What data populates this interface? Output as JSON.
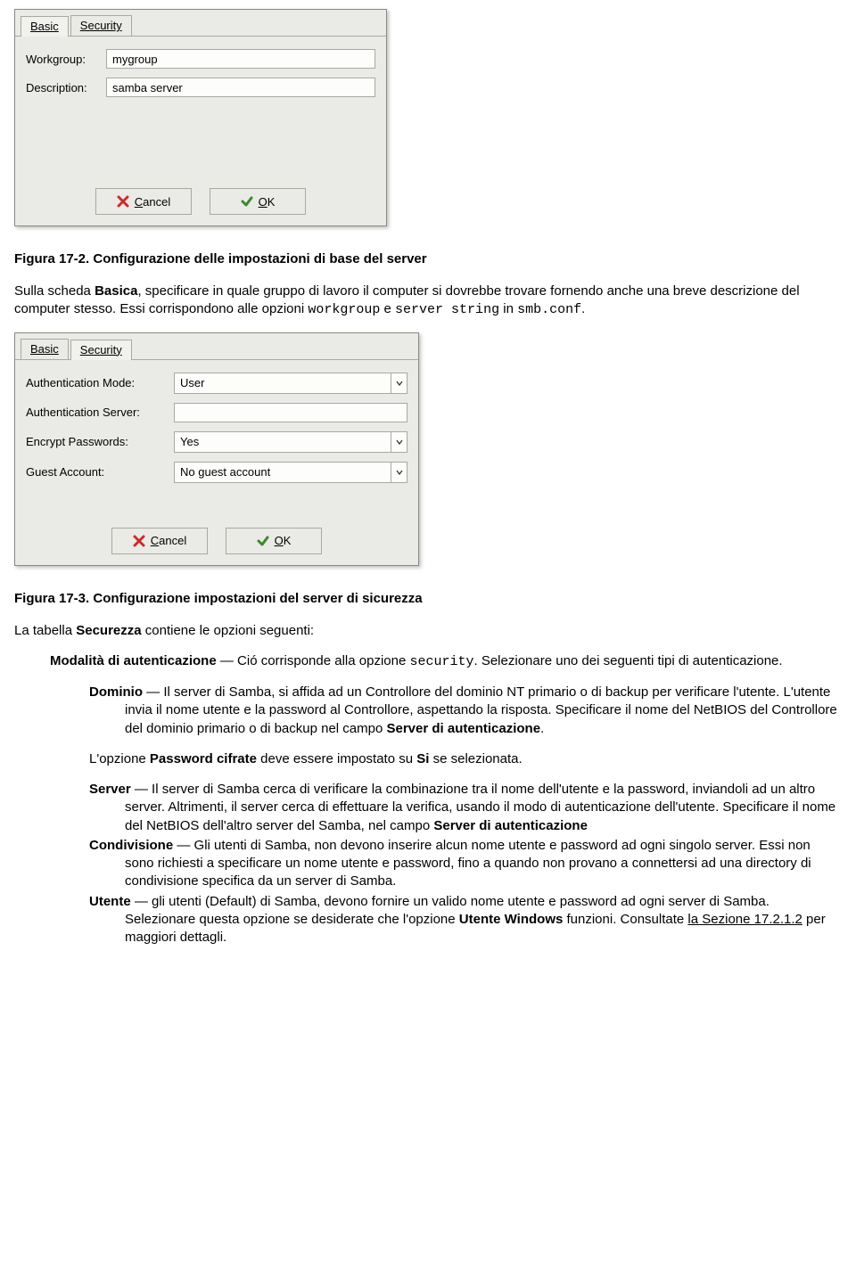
{
  "dialog1": {
    "tab_basic": "Basic",
    "tab_security": "Security",
    "lbl_workgroup": "Workgroup:",
    "val_workgroup": "mygroup",
    "lbl_description": "Description:",
    "val_description": "samba server",
    "btn_cancel": "Cancel",
    "btn_ok": "OK"
  },
  "caption1_pre": "Figura 17-2. Configurazione delle impostazioni di base del server",
  "para1": {
    "t1": "Sulla scheda ",
    "b1": "Basica",
    "t2": ", specificare in quale gruppo di lavoro il computer si dovrebbe trovare fornendo anche una breve descrizione del computer stesso. Essi corrispondono alle opzioni ",
    "m1": "workgroup",
    "t3": " e ",
    "m2": "server string",
    "t4": " in ",
    "m3": "smb.conf",
    "t5": "."
  },
  "dialog2": {
    "tab_basic": "Basic",
    "tab_security": "Security",
    "lbl_authmode": "Authentication Mode:",
    "val_authmode": "User",
    "lbl_authserver": "Authentication Server:",
    "val_authserver": "",
    "lbl_encrypt": "Encrypt Passwords:",
    "val_encrypt": "Yes",
    "lbl_guest": "Guest Account:",
    "val_guest": "No guest account",
    "btn_cancel": "Cancel",
    "btn_ok": "OK"
  },
  "caption2": "Figura 17-3. Configurazione impostazioni del server di sicurezza",
  "para2": {
    "t1": "La tabella ",
    "b1": "Securezza",
    "t2": " contiene le opzioni seguenti:"
  },
  "defs": {
    "modalita": {
      "head_b": "Modalità di autenticazione",
      "head_t1": " — Ció corrisponde alla opzione ",
      "head_m1": "security",
      "head_t2": ". Selezionare uno dei seguenti tipi di autenticazione."
    },
    "dominio": {
      "head_b": "Dominio",
      "body1": " — Il server di Samba, si affida ad un Controllore del dominio NT primario o di backup per verificare l'utente. L'utente invia il nome utente e la password al Controllore, aspettando la risposta. Specificare il nome del NetBIOS del Controllore del dominio primario o di backup nel campo ",
      "body_b1": "Server di autenticazione",
      "body2": ".",
      "p2_t1": "L'opzione ",
      "p2_b1": "Password cifrate",
      "p2_t2": " deve essere impostato su ",
      "p2_b2": "Si",
      "p2_t3": " se selezionata."
    },
    "server": {
      "head_b": "Server",
      "body1": " — Il server di Samba cerca di verificare la combinazione tra il nome dell'utente e la password, inviandoli ad un altro server. Altrimenti, il server cerca di effettuare la verifica, usando il modo di autenticazione dell'utente. Specificare il nome del NetBIOS dell'altro server del Samba, nel campo ",
      "body_b1": "Server di autenticazione"
    },
    "condivisione": {
      "head_b": "Condivisione",
      "body1": " — Gli utenti di Samba, non devono inserire alcun nome utente e password ad ogni singolo server. Essi non sono richiesti a specificare un nome utente e password, fino a quando non provano a connettersi ad una directory di condivisione specifica da un server di Samba."
    },
    "utente": {
      "head_b": "Utente",
      "body1": " — gli utenti (Default) di Samba, devono fornire un valido nome utente e password ad ogni server di Samba. Selezionare questa opzione se desiderate che l'opzione ",
      "body_b1": "Utente Windows",
      "body2": " funzioni. Consultate ",
      "link": "la Sezione 17.2.1.2",
      "body3": " per maggiori dettagli."
    }
  }
}
